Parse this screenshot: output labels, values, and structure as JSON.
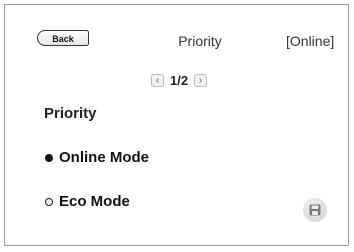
{
  "header": {
    "back_label": "Back",
    "title": "Priority",
    "status": "[Online]"
  },
  "pager": {
    "prev_icon": "chevron-left-icon",
    "page_text": "1/2",
    "next_icon": "chevron-right-icon"
  },
  "section": {
    "label": "Priority"
  },
  "options": [
    {
      "label": "Online Mode",
      "selected": true
    },
    {
      "label": "Eco Mode",
      "selected": false
    }
  ],
  "save": {
    "icon": "save-icon"
  }
}
